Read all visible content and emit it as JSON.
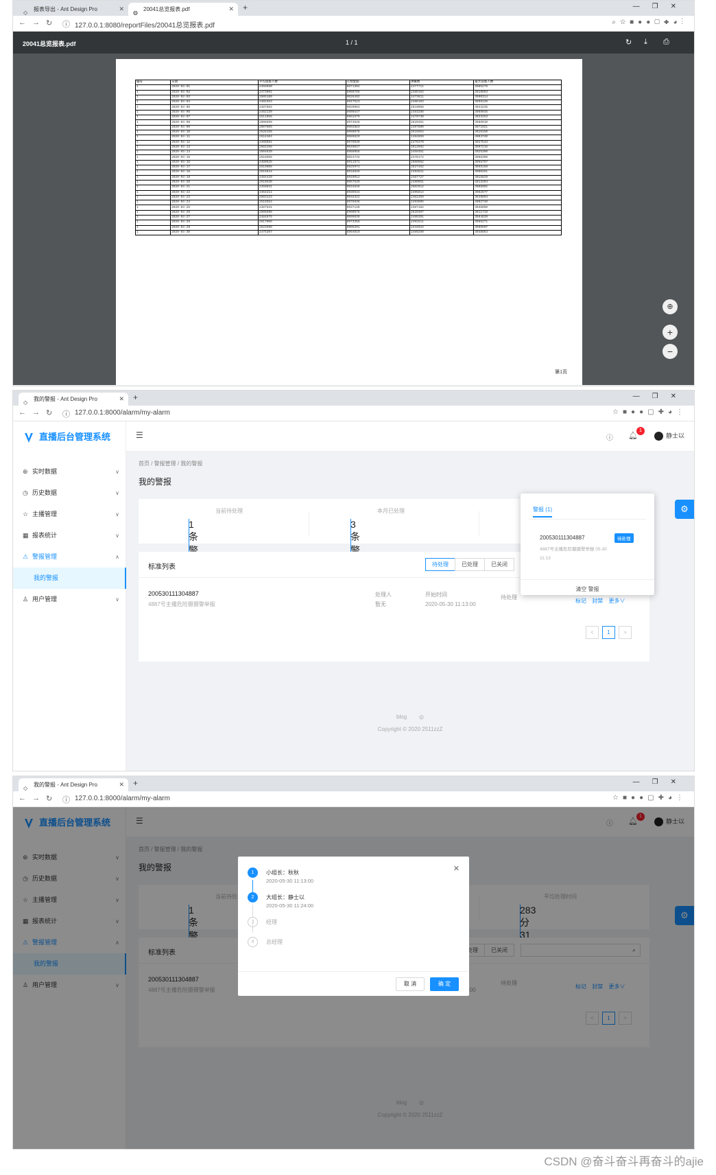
{
  "s1": {
    "tab1": "报表导出 - Ant Design Pro",
    "tab2": "20041总览报表.pdf",
    "url": "127.0.0.1:8080/reportFiles/20041总览报表.pdf",
    "pdf_name": "20041总览报表.pdf",
    "pdf_page": "1 / 1",
    "table_headers": [
      "编号",
      "日期",
      "平均观看人数",
      "礼物金额",
      "弹幕数",
      "最大观看人数"
    ],
    "table_rows": [
      [
        "1",
        "2020-04-01",
        "2468680",
        "8871302",
        "2477711",
        "3985279"
      ],
      [
        "1",
        "2020-04-02",
        "2473901",
        "8960756",
        "2489184",
        "4019893"
      ],
      [
        "1",
        "2020-04-03",
        "2505160",
        "9026492",
        "2473611",
        "3990314"
      ],
      [
        "1",
        "2020-04-04",
        "2465353",
        "8947523",
        "2486103",
        "3998136"
      ],
      [
        "1",
        "2020-04-05",
        "2487894",
        "9020964",
        "2510068",
        "4044235"
      ],
      [
        "1",
        "2020-04-06",
        "2482139",
        "8996547",
        "2483288",
        "3969045"
      ],
      [
        "1",
        "2020-04-07",
        "2511056",
        "9062679",
        "2470730",
        "4033253"
      ],
      [
        "1",
        "2020-04-08",
        "2508599",
        "8974646",
        "2529351",
        "3986010"
      ],
      [
        "1",
        "2020-04-09",
        "2507605",
        "9003883",
        "2497800",
        "3971021"
      ],
      [
        "1",
        "2020-04-10",
        "2528166",
        "9060078",
        "2516954",
        "4016150"
      ],
      [
        "1",
        "2020-04-11",
        "2518104",
        "9089629",
        "2484859",
        "4004740"
      ],
      [
        "1",
        "2020-04-12",
        "2468681",
        "9070930",
        "2476370",
        "3927543"
      ],
      [
        "1",
        "2020-04-13",
        "2502256",
        "9040047",
        "2512692",
        "3997215"
      ],
      [
        "1",
        "2020-04-14",
        "2504639",
        "8988058",
        "2459351",
        "4025390"
      ],
      [
        "1",
        "2020-04-15",
        "2518656",
        "9024744",
        "2478172",
        "3988309"
      ],
      [
        "1",
        "2020-04-16",
        "2480525",
        "8911571",
        "2500962",
        "3958797"
      ],
      [
        "1",
        "2020-04-17",
        "2519606",
        "8925974",
        "2527452",
        "3955158"
      ],
      [
        "1",
        "2020-04-18",
        "2515844",
        "9018829",
        "2493621",
        "4060261"
      ],
      [
        "1",
        "2020-04-19",
        "2484429",
        "8949012",
        "2487727",
        "4015829"
      ],
      [
        "1",
        "2020-04-20",
        "2510530",
        "9057549",
        "2489051",
        "4013404"
      ],
      [
        "1",
        "2020-04-21",
        "2450831",
        "9034846",
        "2502912",
        "4008902"
      ],
      [
        "1",
        "2020-04-22",
        "2464211",
        "8939644",
        "2495814",
        "3982677"
      ],
      [
        "1",
        "2020-04-23",
        "2503123",
        "9048322",
        "2481359",
        "3949894"
      ],
      [
        "1",
        "2020-04-24",
        "2510354",
        "8976836",
        "2493805",
        "4002740"
      ],
      [
        "1",
        "2020-04-25",
        "2487531",
        "9037146",
        "2487162",
        "4038050"
      ],
      [
        "1",
        "2020-04-26",
        "2505596",
        "8990076",
        "2520407",
        "4011719"
      ],
      [
        "1",
        "2020-04-27",
        "2484675",
        "9009039",
        "2499391",
        "3984839"
      ],
      [
        "1",
        "2020-04-28",
        "2517065",
        "8973358",
        "2491511",
        "3986271"
      ],
      [
        "1",
        "2020-04-29",
        "2522598",
        "9005201",
        "2444624",
        "3996507"
      ],
      [
        "1",
        "2020-04-30",
        "2475397",
        "8994010",
        "2489260",
        "4048864"
      ]
    ],
    "page_footer": "第1页"
  },
  "app": {
    "tab": "我的警报 - Ant Design Pro",
    "url": "127.0.0.1:8000/alarm/my-alarm",
    "logo": "直播后台管理系统",
    "menu": [
      "实时数据",
      "历史数据",
      "主播管理",
      "报表统计",
      "警报管理",
      "我的警报",
      "用户管理"
    ],
    "user": "静士以",
    "badge": "1",
    "crumbs": "首页 / 警报管理 / 我的警报",
    "title": "我的警报",
    "stat1_label": "当前待处理",
    "stat1_value": "1条警报",
    "stat2_label": "本月已处理",
    "stat2_value": "3条警报",
    "stat3_label": "平均处理时间",
    "stat3_value": "283分31秒",
    "list_title": "标准列表",
    "radio": [
      "待处理",
      "已处理",
      "已关闭"
    ],
    "row_id": "200530111304887",
    "row_desc": "4887号主播危险摄摄警举报",
    "handler_label": "处理人",
    "handler_value": "暂无",
    "start_label": "开始时间",
    "start_value": "2020-05-30 11:13:00",
    "status": "待处理",
    "actions": "标记 封禁 更多∨",
    "page_no": "1",
    "footer_blog": "blog",
    "copyright": "Copyright © 2020 2511zzZ"
  },
  "popover": {
    "tab_label": "警报 (1)",
    "item_id": "200530111304887",
    "tag": "待处理",
    "desc": "4887号主播危险摄摄警举报 05-30 11:13",
    "clear": "清空 警报"
  },
  "modal": {
    "steps": [
      {
        "n": "1",
        "title": "小组长：秋秋",
        "time": "2020-05-30 11:13:00",
        "done": true
      },
      {
        "n": "2",
        "title": "大组长：静士以",
        "time": "2020-05-30 11:24:00",
        "done": true
      },
      {
        "n": "3",
        "title": "经理",
        "time": "",
        "done": false
      },
      {
        "n": "4",
        "title": "总经理",
        "time": "",
        "done": false
      }
    ],
    "cancel": "取 消",
    "ok": "确 定"
  },
  "watermark": "CSDN @奋斗奋斗再奋斗的ajie",
  "colors": {
    "primary": "#1890ff",
    "badge": "#f5222d",
    "pdf_toolbar": "#323639"
  }
}
